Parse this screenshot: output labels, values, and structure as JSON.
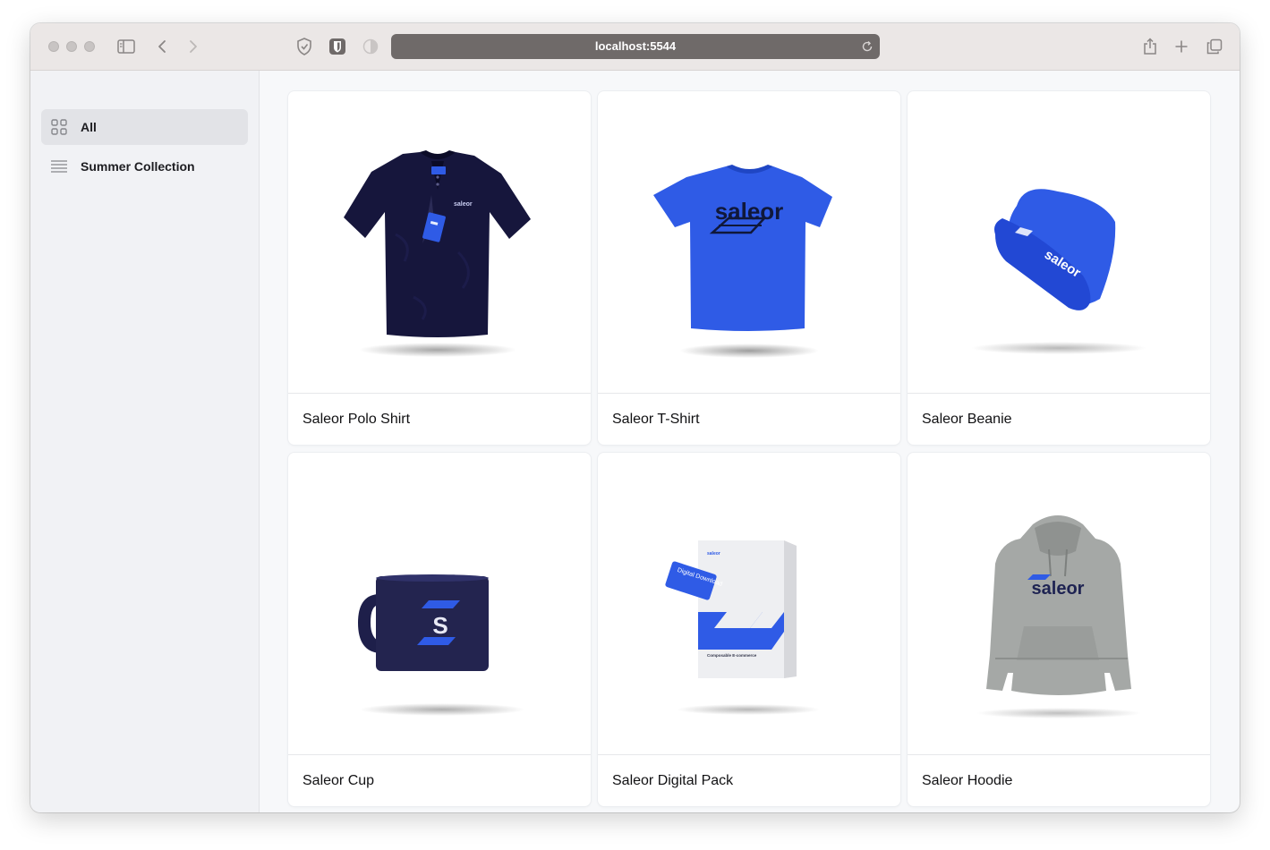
{
  "browser": {
    "url": "localhost:5544",
    "icons": [
      "sidebar-toggle-icon",
      "back-icon",
      "forward-icon",
      "privacy-shield-icon",
      "bitwarden-icon",
      "reader-icon",
      "reload-icon",
      "share-icon",
      "new-tab-icon",
      "tab-overview-icon"
    ]
  },
  "sidebar": {
    "items": [
      {
        "label": "All",
        "icon": "grid-icon",
        "active": true
      },
      {
        "label": "Summer Collection",
        "icon": "list-icon",
        "active": false
      }
    ]
  },
  "products": [
    {
      "name": "Saleor Polo Shirt",
      "image": "polo-shirt"
    },
    {
      "name": "Saleor T-Shirt",
      "image": "t-shirt"
    },
    {
      "name": "Saleor Beanie",
      "image": "beanie"
    },
    {
      "name": "Saleor Cup",
      "image": "cup"
    },
    {
      "name": "Saleor Digital Pack",
      "image": "digital-pack"
    },
    {
      "name": "Saleor Hoodie",
      "image": "hoodie"
    }
  ],
  "image_text": {
    "tshirt": "saleor",
    "beanie": "saleor",
    "cup": "S",
    "hoodie": "saleor",
    "pack_card": "Digital Download",
    "pack_box": "Composable E-commerce"
  },
  "colors": {
    "accent_blue": "#2f5be6",
    "navy": "#14143a",
    "hoodie_gray": "#a5a8a6"
  }
}
